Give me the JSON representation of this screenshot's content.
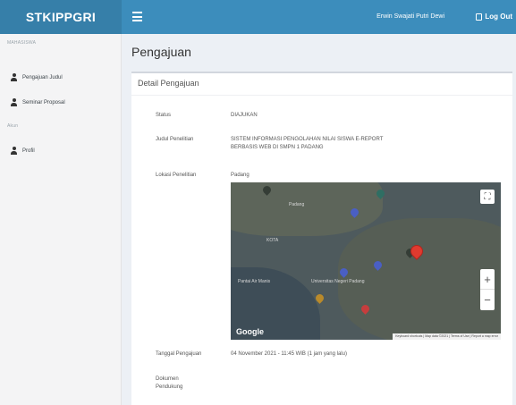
{
  "header": {
    "brand": "STKIPPGRI",
    "user": "Erwin Swajati Putri Dewi",
    "logout": "Log Out"
  },
  "sidebar": {
    "section1": "MAHASISWA",
    "items1": [
      {
        "label": "Pengajuan Judul",
        "icon": "user-icon"
      },
      {
        "label": "Seminar Proposal",
        "icon": "user-icon"
      }
    ],
    "section2": "Akun",
    "items2": [
      {
        "label": "Profil",
        "icon": "user-icon"
      }
    ]
  },
  "main": {
    "title": "Pengajuan",
    "card_title": "Detail Pengajuan",
    "fields": {
      "status_label": "Status",
      "status_value": "DIAJUKAN",
      "judul_label": "Judul Penelitian",
      "judul_value": "SISTEM INFORMASI PENGOLAHAN NILAI SISWA E-REPORT BERBASIS WEB DI SMPN 1 PADANG",
      "lokasi_label": "Lokasi Penelitian",
      "lokasi_value": "Padang",
      "tanggal_label": "Tanggal Pengajuan",
      "tanggal_value": "04 November 2021 - 11:45 WIB (1 jam yang lalu)",
      "dokumen_label": "Dokumen Pendukung"
    },
    "map": {
      "logo": "Google",
      "attribution": "Keyboard shortcuts | Map data ©2021 | Terms of Use | Report a map error",
      "zoom_in": "+",
      "zoom_out": "−",
      "fullscreen": "⛶",
      "labels": {
        "a": "Padang",
        "b": "KOTA",
        "c": "Pantai Air Manis",
        "d": "Universitas Negeri Padang"
      }
    }
  }
}
